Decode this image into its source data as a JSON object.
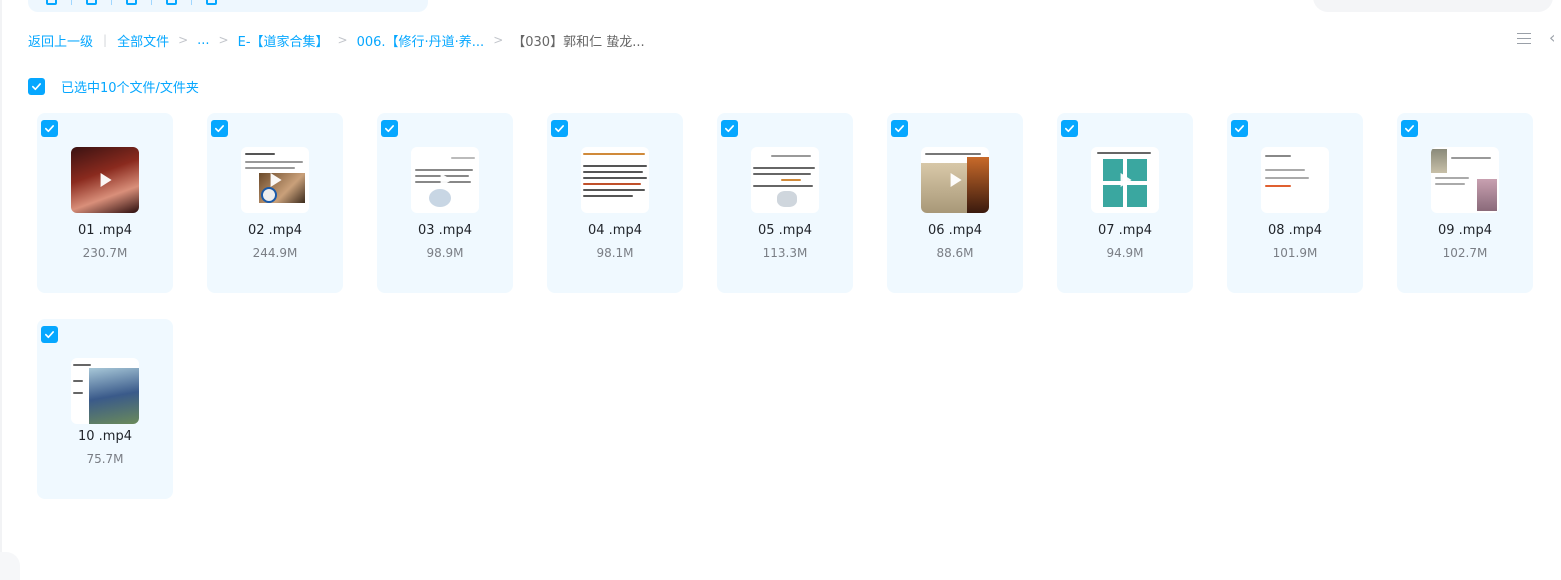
{
  "breadcrumb": {
    "back": "返回上一级",
    "all_files": "全部文件",
    "ellipsis": "...",
    "level1": "E-【道家合集】",
    "level2": "006.【修行·丹道·养...",
    "current": "【030】郭和仁 蛰龙..."
  },
  "selection": {
    "label": "已选中10个文件/文件夹",
    "all_selected": true
  },
  "colors": {
    "accent": "#06a7ff",
    "card_bg": "#f0f9ff"
  },
  "icons": {
    "checkbox": "check-icon",
    "view": "list-view-icon",
    "collapse": "chevron-left-icon",
    "play": "play-icon"
  },
  "files": [
    {
      "name": "01 .mp4",
      "size": "230.7M",
      "checked": true
    },
    {
      "name": "02 .mp4",
      "size": "244.9M",
      "checked": true
    },
    {
      "name": "03 .mp4",
      "size": "98.9M",
      "checked": true
    },
    {
      "name": "04 .mp4",
      "size": "98.1M",
      "checked": true
    },
    {
      "name": "05 .mp4",
      "size": "113.3M",
      "checked": true
    },
    {
      "name": "06 .mp4",
      "size": "88.6M",
      "checked": true
    },
    {
      "name": "07 .mp4",
      "size": "94.9M",
      "checked": true
    },
    {
      "name": "08 .mp4",
      "size": "101.9M",
      "checked": true
    },
    {
      "name": "09 .mp4",
      "size": "102.7M",
      "checked": true
    },
    {
      "name": "10 .mp4",
      "size": "75.7M",
      "checked": true
    }
  ]
}
